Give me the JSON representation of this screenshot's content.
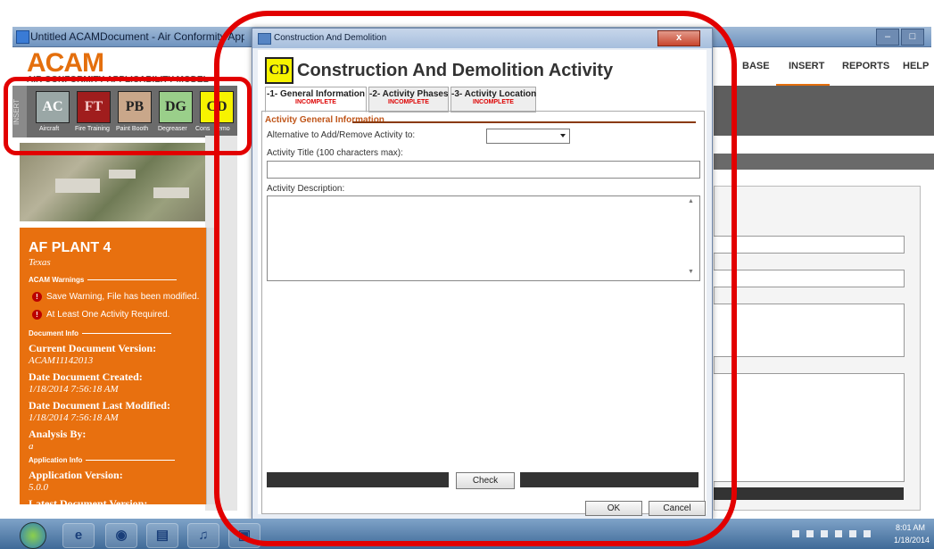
{
  "app": {
    "window_title": "Untitled ACAMDocument - Air Conformity Applicability M",
    "logo": "ACAM",
    "logo_subtitle": "AIR CONFORMITY APPLICABILITY MODEL"
  },
  "ribbon": {
    "group_label": "INSERT",
    "buttons": [
      {
        "abbr": "AC",
        "label": "Aircraft",
        "color": "#9aa7a6"
      },
      {
        "abbr": "FT",
        "label": "Fire Training",
        "color": "#a01d1d"
      },
      {
        "abbr": "PB",
        "label": "Paint Booth",
        "color": "#c9a78a"
      },
      {
        "abbr": "DG",
        "label": "Degreaser",
        "color": "#9acf8a"
      },
      {
        "abbr": "CD",
        "label": "Cons",
        "color": "#f7f300"
      }
    ],
    "extra_label": "emo"
  },
  "menu": [
    "BASE",
    "INSERT",
    "REPORTS",
    "HELP"
  ],
  "plant": {
    "name": "AF PLANT 4",
    "state": "Texas",
    "warnings_header": "ACAM Warnings",
    "warnings": [
      "Save Warning, File has been modified.",
      "At Least One Activity Required."
    ],
    "doc_info_header": "Document Info",
    "doc_info": [
      {
        "key": "Current Document Version:",
        "value": "ACAM11142013"
      },
      {
        "key": "Date Document Created:",
        "value": "1/18/2014 7:56:18 AM"
      },
      {
        "key": "Date Document Last Modified:",
        "value": "1/18/2014 7:56:18 AM"
      },
      {
        "key": "Analysis By:",
        "value": "a"
      }
    ],
    "app_info_header": "Application Info",
    "app_info": [
      {
        "key": "Application Version:",
        "value": "5.0.0"
      },
      {
        "key": "Latest Document Version:",
        "value": ""
      }
    ]
  },
  "dialog": {
    "window_title": "Construction And Demolition",
    "close_glyph": "x",
    "badge": "CD",
    "heading": "Construction And Demolition Activity",
    "tabs": [
      {
        "label": "-1- General Information",
        "status": "INCOMPLETE"
      },
      {
        "label": "-2- Activity Phases",
        "status": "INCOMPLETE"
      },
      {
        "label": "-3- Activity Location",
        "status": "INCOMPLETE"
      }
    ],
    "section_title": "Activity General Information",
    "alt_label": "Alternative to Add/Remove Activity to:",
    "alt_value": "",
    "title_label": "Activity Title (100 characters max):",
    "title_value": "",
    "desc_label": "Activity Description:",
    "desc_value": "",
    "check_label": "Check",
    "ok_label": "OK",
    "cancel_label": "Cancel"
  },
  "taskbar": {
    "time": "8:01 AM",
    "date": "1/18/2014"
  },
  "annotation_color": "#e20000"
}
